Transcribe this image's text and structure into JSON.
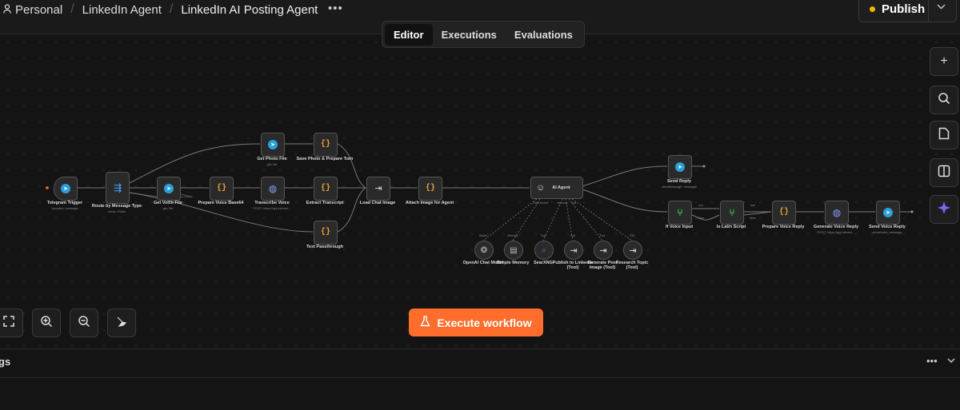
{
  "breadcrumbs": {
    "personal": "Personal",
    "project": "LinkedIn Agent",
    "workflow": "LinkedIn AI Posting Agent"
  },
  "more_label": "•••",
  "publish": {
    "label": "Publish",
    "status_color": "#f4b400"
  },
  "tabs": {
    "editor": "Editor",
    "executions": "Executions",
    "evaluations": "Evaluations",
    "active": "Editor"
  },
  "nodes": {
    "telegram_trigger": {
      "label": "Telegram Trigger",
      "sub": "Updates: message"
    },
    "route": {
      "label": "Route by Message Type",
      "sub": "mode: Rules"
    },
    "get_voice": {
      "label": "Get Voice File",
      "sub": "get: file"
    },
    "prep_voice": {
      "label": "Prepare Voice Base64"
    },
    "transcribe": {
      "label": "Transcribe Voice",
      "sub": "POST: https://api.elevenl..."
    },
    "extract": {
      "label": "Extract Transcript"
    },
    "get_photo": {
      "label": "Get Photo File",
      "sub": "get: file"
    },
    "save_photo": {
      "label": "Save Photo & Prepare Turn"
    },
    "text_pass": {
      "label": "Text Passthrough"
    },
    "load_chat": {
      "label": "Load Chat Image"
    },
    "attach_img": {
      "label": "Attach Image for Agent"
    },
    "ai_agent": {
      "label": "AI Agent",
      "port_chat": "Chat Model*",
      "port_memory": "Memory",
      "port_tool": "Tool"
    },
    "send_reply": {
      "label": "Send Reply",
      "sub": "sendMessage: message"
    },
    "if_voice": {
      "label": "If Voice Input",
      "true": "true",
      "false": "false"
    },
    "is_latin": {
      "label": "Is Latin Script",
      "true": "true",
      "false": "false"
    },
    "prep_voice_reply": {
      "label": "Prepare Voice Reply"
    },
    "gen_voice": {
      "label": "Generate Voice Reply",
      "sub": "POST: https://api.elevenl..."
    },
    "send_voice": {
      "label": "Send Voice Reply",
      "sub": "sendAudio: message"
    }
  },
  "sub_nodes": {
    "openai": {
      "label": "OpenAI Chat Model",
      "port": "Model"
    },
    "memory": {
      "label": "Simple Memory",
      "port": "Memory"
    },
    "searxng": {
      "label": "SearXNG",
      "port": "Tool"
    },
    "publish_li": {
      "label": "Publish to LinkedIn (Tool)",
      "port": "Tool"
    },
    "gen_post_img": {
      "label": "Generate Post Image (Tool)",
      "port": "Tool"
    },
    "research": {
      "label": "Research Topic (Tool)",
      "port": "Tool"
    }
  },
  "right_toolbar": {
    "add": "+",
    "search": "⌕",
    "note": "▢",
    "panel": "◧",
    "ai": "✦"
  },
  "zoom_controls": {
    "fit": "⛶",
    "zoom_in": "⊕",
    "zoom_out": "⊖",
    "clean": "⌫"
  },
  "execute": {
    "label": "Execute workflow"
  },
  "logs": {
    "label": "gs"
  },
  "colors": {
    "accent": "#ff6d2d",
    "telegram": "#2aa0da",
    "if_green": "#37c45e",
    "ai_purple": "#8b5cf6"
  }
}
